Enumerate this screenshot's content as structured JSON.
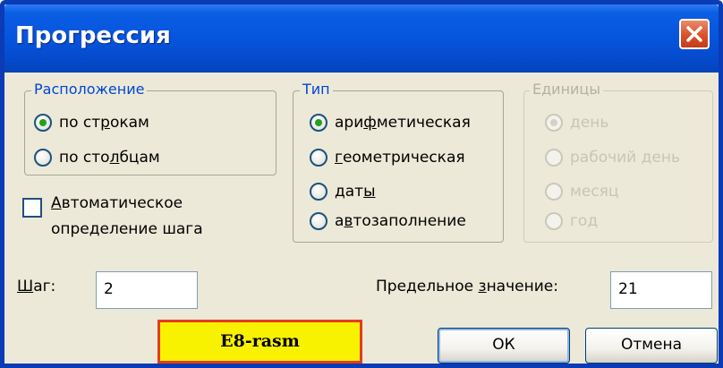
{
  "window": {
    "title": "Прогрессия"
  },
  "arrangement": {
    "legend": "Расположение",
    "options": [
      {
        "pre": "по ст",
        "u": "р",
        "post": "окам",
        "checked": true
      },
      {
        "pre": "по сто",
        "u": "л",
        "post": "бцам",
        "checked": false
      }
    ]
  },
  "type": {
    "legend": "Тип",
    "options": [
      {
        "pre": "ари",
        "u": "ф",
        "post": "метическая",
        "checked": true
      },
      {
        "pre": "",
        "u": "г",
        "post": "еометрическая",
        "checked": false
      },
      {
        "pre": "дат",
        "u": "ы",
        "post": "",
        "checked": false
      },
      {
        "pre": "а",
        "u": "в",
        "post": "тозаполнение",
        "checked": false
      }
    ]
  },
  "units": {
    "legend": "Единицы",
    "disabled": true,
    "options": [
      {
        "label": "день",
        "checked": true
      },
      {
        "label": "рабочий день",
        "checked": false
      },
      {
        "label": "месяц",
        "checked": false
      },
      {
        "label": "год",
        "checked": false
      }
    ]
  },
  "auto_step": {
    "line1_u": "А",
    "line1_rest": "втоматическое",
    "line2": "определение шага",
    "checked": false
  },
  "step": {
    "label_u": "Ш",
    "label_rest": "аг:",
    "value": "2"
  },
  "limit": {
    "label_pre": "Предельное ",
    "label_u": "з",
    "label_post": "начение:",
    "value": "21"
  },
  "buttons": {
    "ok": "ОК",
    "cancel": "Отмена"
  },
  "caption": "E8-rasm",
  "colors": {
    "title_bar": "#0654dd",
    "caption_bg": "#f8f200",
    "caption_border": "#e53b20",
    "close_button": "#d8522a"
  }
}
